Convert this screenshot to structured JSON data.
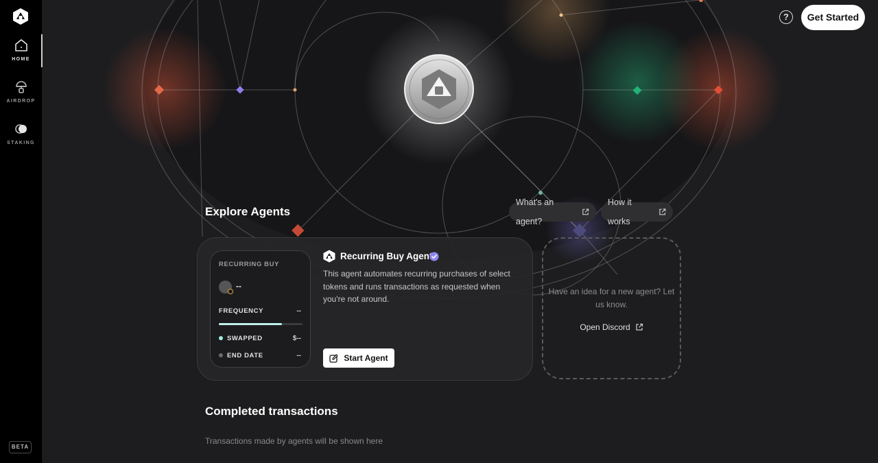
{
  "sidebar": {
    "items": [
      {
        "label": "HOME",
        "icon": "home-icon",
        "active": true
      },
      {
        "label": "AIRDROP",
        "icon": "parachute-icon",
        "active": false
      },
      {
        "label": "STAKING",
        "icon": "staking-icon",
        "active": false
      }
    ],
    "badge": "BETA"
  },
  "header": {
    "help_icon": "?",
    "cta_label": "Get Started"
  },
  "explore": {
    "title": "Explore Agents",
    "links": [
      {
        "label": "What's an agent?",
        "icon": "external-link-icon"
      },
      {
        "label": "How it works",
        "icon": "external-link-icon"
      }
    ]
  },
  "agent_card": {
    "preview": {
      "title": "RECURRING BUY",
      "amount": "--",
      "frequency_label": "FREQUENCY",
      "frequency_value": "--",
      "progress": 0.75,
      "swapped_label": "SWAPPED",
      "swapped_value": "$--",
      "end_date_label": "END DATE",
      "end_date_value": "--"
    },
    "name": "Recurring Buy Agent",
    "verified": true,
    "description": "This agent automates recurring purchases of select tokens and runs transactions as requested when you're not around.",
    "start_label": "Start Agent"
  },
  "idea_card": {
    "text": "Have an idea for a new agent? Let us know.",
    "link_label": "Open Discord"
  },
  "transactions": {
    "title": "Completed transactions",
    "empty_text": "Transactions made by agents will be shown here"
  },
  "colors": {
    "accent_teal": "#bff1ec",
    "swapped_dot": "#9ff0e0",
    "end_dot": "#6b6b6b",
    "verified": "#8e86f0"
  }
}
